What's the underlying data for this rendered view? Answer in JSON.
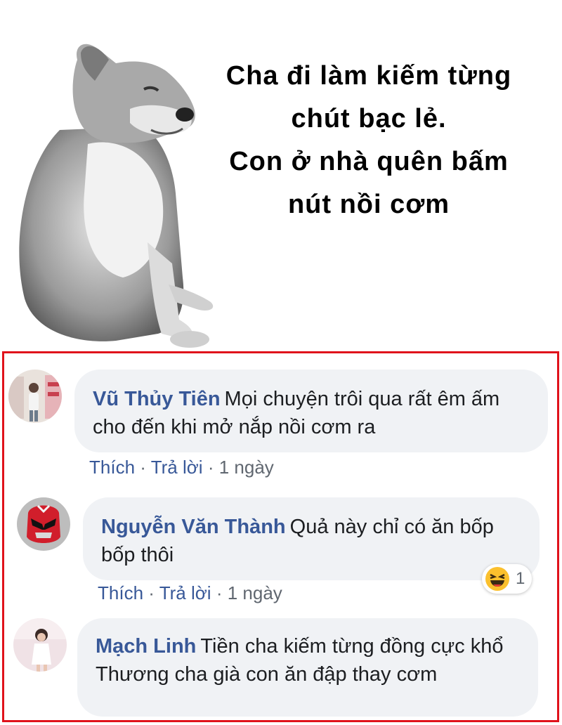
{
  "meme": {
    "caption_lines": [
      "Cha đi làm kiếm từng",
      "chút bạc lẻ.",
      "Con ở nhà quên bấm",
      "nút nồi cơm"
    ]
  },
  "comments": [
    {
      "author": "Vũ Thủy Tiên",
      "text": "Mọi chuyện trôi qua rất êm ấm cho đến khi mở nắp nồi cơm ra",
      "like_label": "Thích",
      "reply_label": "Trả lời",
      "separator": "·",
      "time": "1 ngày"
    },
    {
      "author": "Nguyễn Văn Thành",
      "text": "Quả này chỉ có ăn bốp bốp thôi",
      "like_label": "Thích",
      "reply_label": "Trả lời",
      "separator": "·",
      "time": "1 ngày",
      "reaction": {
        "icon": "haha-emoji-icon",
        "count": "1"
      }
    },
    {
      "author": "Mạch Linh",
      "text": "Tiền cha kiếm từng đồng cực khổ",
      "text_line2": "Thương cha già con ăn đập thay cơm"
    }
  ],
  "colors": {
    "frame_border": "#e0121b",
    "author": "#385898",
    "bubble_bg": "#f0f2f5"
  }
}
